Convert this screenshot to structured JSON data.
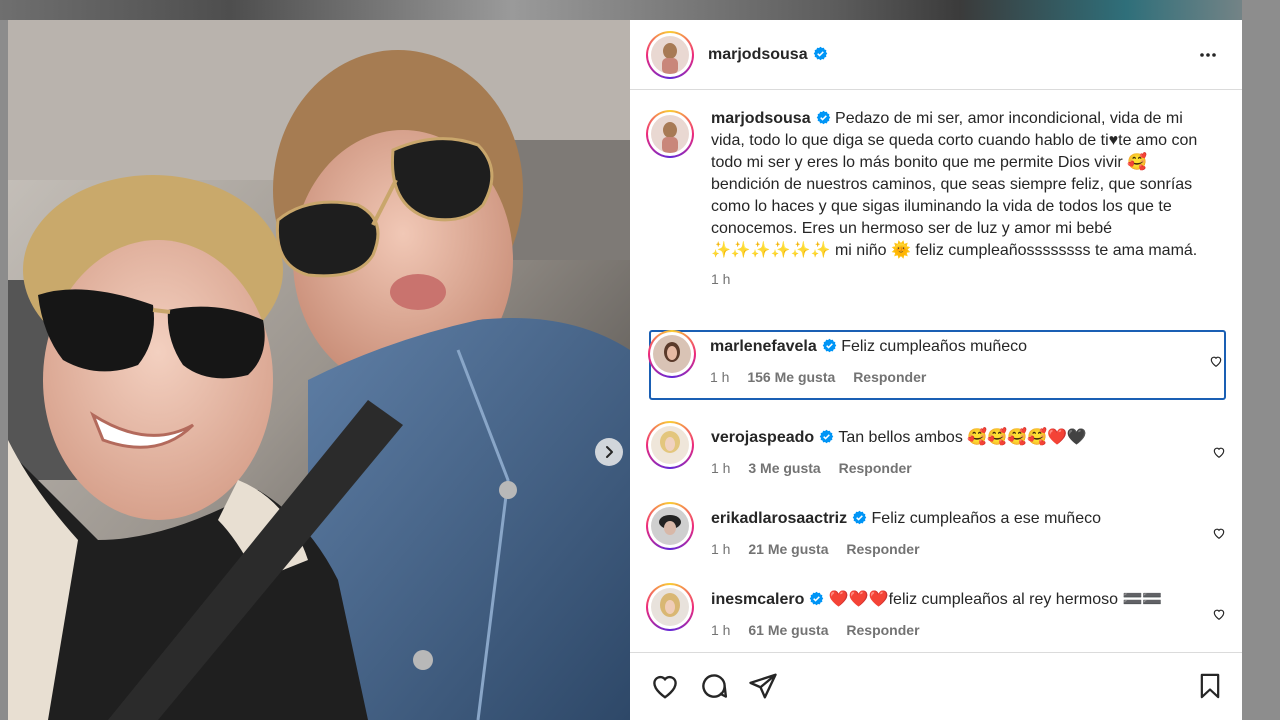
{
  "post": {
    "author": "marjodsousa",
    "caption": "Pedazo de mi ser, amor incondicional, vida de mi vida, todo lo que diga se queda corto cuando hablo de ti♥︎te amo con todo mi ser y eres lo más bonito que me permite Dios vivir 🥰bendición de nuestros caminos, que seas siempre feliz, que sonrías como lo haces y que sigas iluminando la vida de todos los que te conocemos. Eres un hermoso ser de luz y amor mi bebé ✨✨✨✨✨✨ mi niño 🌞 feliz cumpleañossssssss te ama mamá.",
    "time": "1 h"
  },
  "comments": [
    {
      "user": "marlenefavela",
      "verified": true,
      "text": "Feliz cumpleaños muñeco",
      "time": "1 h",
      "likes": "156 Me gusta",
      "reply": "Responder"
    },
    {
      "user": "verojaspeado",
      "verified": true,
      "text": "Tan bellos ambos 🥰🥰🥰🥰❤️🖤",
      "time": "1 h",
      "likes": "3 Me gusta",
      "reply": "Responder"
    },
    {
      "user": "erikadlarosaactriz",
      "verified": true,
      "text": "Feliz cumpleaños a ese muñeco",
      "time": "1 h",
      "likes": "21 Me gusta",
      "reply": "Responder"
    },
    {
      "user": "inesmcalero",
      "verified": true,
      "text": "❤️❤️❤️feliz cumpleaños al rey hermoso 🟰🟰",
      "time": "1 h",
      "likes": "61 Me gusta",
      "reply": "Responder"
    }
  ],
  "icons": {
    "more": "more-options-icon",
    "like": "heart-icon",
    "comment": "comment-icon",
    "share": "share-icon",
    "save": "bookmark-icon",
    "next": "chevron-right-icon",
    "verified": "verified-badge-icon"
  },
  "colors": {
    "verified": "#0095f6",
    "highlight_border": "#1a5fb4",
    "secondary_text": "#737373"
  }
}
